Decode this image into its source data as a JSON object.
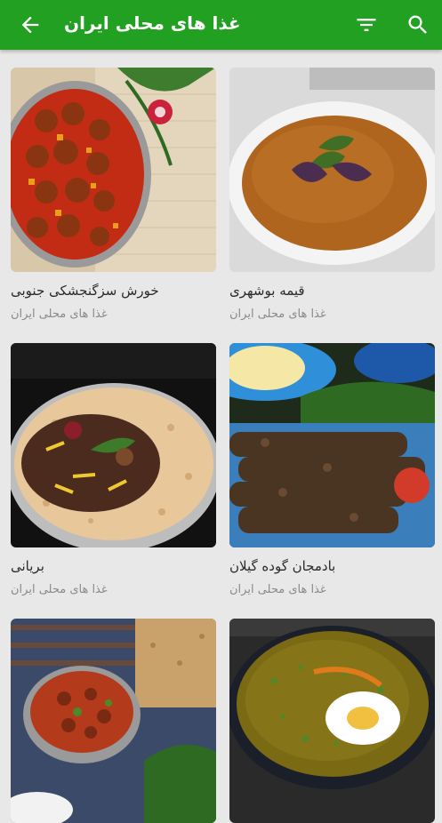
{
  "appbar": {
    "title": "غذا های محلی ایران",
    "back_icon": "arrow-back-icon",
    "filter_icon": "filter-icon",
    "search_icon": "search-icon",
    "color": "#21a021"
  },
  "cards": [
    {
      "name": "خورش سزگنجشکی جنوبی",
      "category": "غذا های محلی ایران"
    },
    {
      "name": "قیمه بوشهری",
      "category": "غذا های محلی ایران"
    },
    {
      "name": "بریانی",
      "category": "غذا های محلی ایران"
    },
    {
      "name": "بادمجان گوده گیلان",
      "category": "غذا های محلی ایران"
    },
    {
      "name": "",
      "category": ""
    },
    {
      "name": "",
      "category": ""
    }
  ]
}
